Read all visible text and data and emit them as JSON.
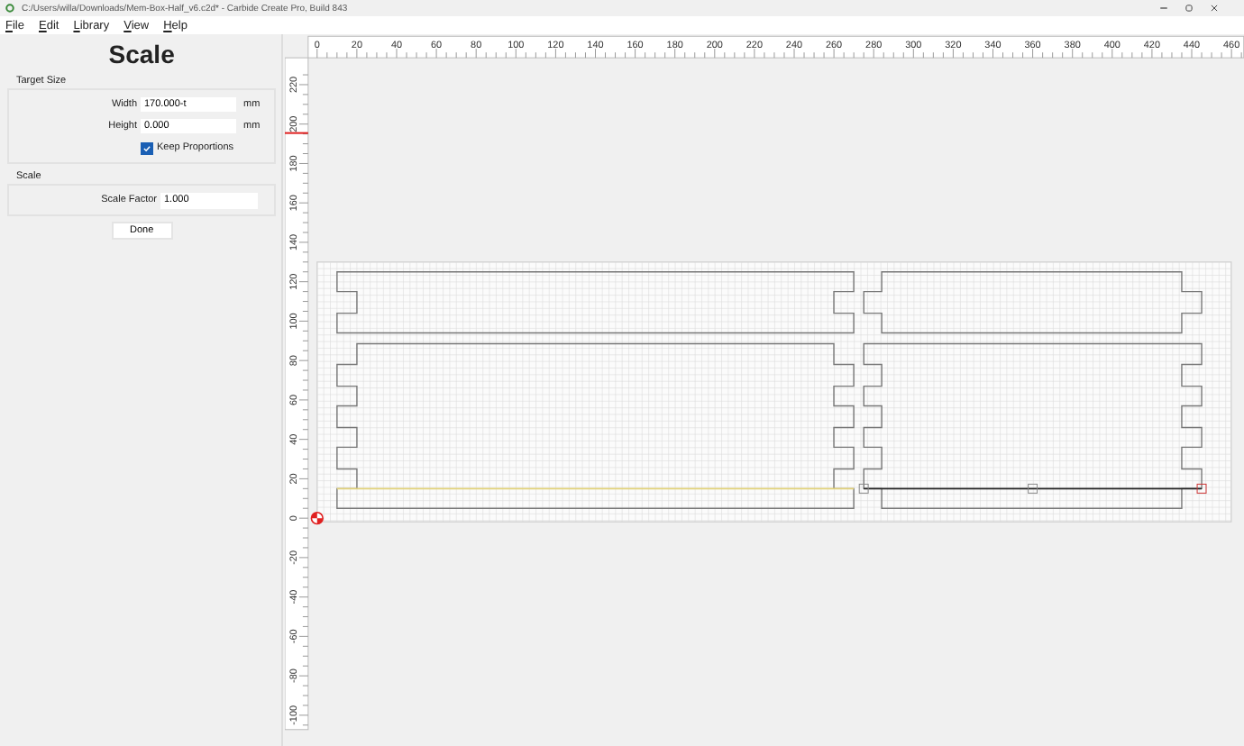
{
  "window": {
    "title": "C:/Users/willa/Downloads/Mem-Box-Half_v6.c2d* - Carbide Create Pro, Build 843"
  },
  "menu": [
    {
      "label": "File"
    },
    {
      "label": "Edit"
    },
    {
      "label": "Library"
    },
    {
      "label": "View"
    },
    {
      "label": "Help"
    }
  ],
  "panel": {
    "title": "Scale",
    "target_size": {
      "heading": "Target Size",
      "width": {
        "label": "Width",
        "value": "170.000-t",
        "unit": "mm"
      },
      "height": {
        "label": "Height",
        "value": "0.000",
        "unit": "mm"
      },
      "keep_proportions": {
        "label": "Keep Proportions",
        "checked": true
      }
    },
    "scale": {
      "heading": "Scale",
      "factor": {
        "label": "Scale Factor",
        "value": "1.000"
      }
    },
    "done_button": "Done"
  },
  "canvas": {
    "horizontal_ruler": [
      "0",
      "20",
      "40",
      "60",
      "80",
      "100",
      "120",
      "140",
      "160",
      "180",
      "200",
      "220",
      "240",
      "260",
      "280",
      "300",
      "320",
      "340",
      "360",
      "380",
      "400",
      "420",
      "440",
      "460"
    ],
    "vertical_ruler": [
      "220",
      "200",
      "180",
      "160",
      "140",
      "120",
      "100",
      "80",
      "60",
      "40",
      "20",
      "0",
      "-20",
      "-40",
      "-60",
      "-80",
      "-100"
    ]
  }
}
